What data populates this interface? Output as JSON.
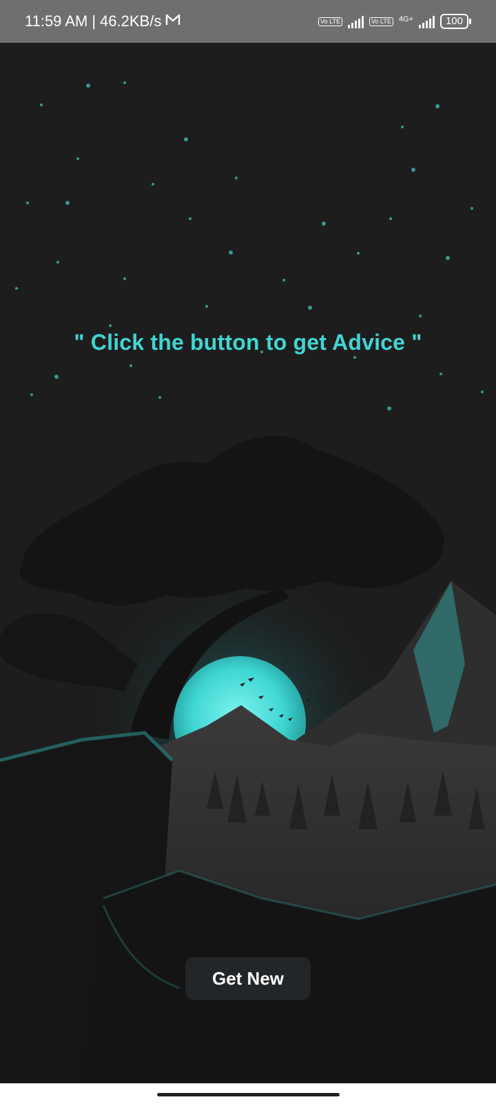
{
  "status_bar": {
    "time": "11:59 AM",
    "separator": "|",
    "net_speed": "46.2KB/s",
    "mail_icon": "gmail-icon",
    "volte_1": "Vo LTE",
    "volte_2": "Vo LTE",
    "network_type": "4G+",
    "battery": "100"
  },
  "main": {
    "advice_text": "\" Click the button to get Advice \"",
    "button_label": "Get New"
  },
  "colors": {
    "accent": "#3fd6d3",
    "background": "#1c1c1c",
    "button_bg": "#232629"
  },
  "icons": [
    "gmail-icon",
    "volte-icon",
    "signal-icon",
    "battery-icon"
  ]
}
